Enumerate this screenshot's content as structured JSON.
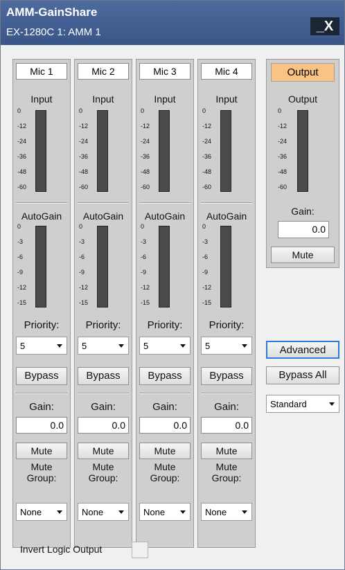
{
  "window": {
    "title": "AMM-GainShare",
    "subtitle": "EX-1280C 1: AMM 1",
    "close_label": "_X"
  },
  "channels": [
    {
      "name": "Mic 1",
      "input_label": "Input",
      "autogain_label": "AutoGain",
      "priority_label": "Priority:",
      "priority_value": "5",
      "bypass_label": "Bypass",
      "gain_label": "Gain:",
      "gain_value": "0.0",
      "mute_label": "Mute",
      "mute_group_label": "Mute Group:",
      "mute_group_value": "None"
    },
    {
      "name": "Mic 2",
      "input_label": "Input",
      "autogain_label": "AutoGain",
      "priority_label": "Priority:",
      "priority_value": "5",
      "bypass_label": "Bypass",
      "gain_label": "Gain:",
      "gain_value": "0.0",
      "mute_label": "Mute",
      "mute_group_label": "Mute Group:",
      "mute_group_value": "None"
    },
    {
      "name": "Mic 3",
      "input_label": "Input",
      "autogain_label": "AutoGain",
      "priority_label": "Priority:",
      "priority_value": "5",
      "bypass_label": "Bypass",
      "gain_label": "Gain:",
      "gain_value": "0.0",
      "mute_label": "Mute",
      "mute_group_label": "Mute Group:",
      "mute_group_value": "None"
    },
    {
      "name": "Mic 4",
      "input_label": "Input",
      "autogain_label": "AutoGain",
      "priority_label": "Priority:",
      "priority_value": "5",
      "bypass_label": "Bypass",
      "gain_label": "Gain:",
      "gain_value": "0.0",
      "mute_label": "Mute",
      "mute_group_label": "Mute Group:",
      "mute_group_value": "None"
    }
  ],
  "input_scale": [
    "0",
    "-12",
    "-24",
    "-36",
    "-48",
    "-60"
  ],
  "autogain_scale": [
    "0",
    "-3",
    "-6",
    "-9",
    "-12",
    "-15"
  ],
  "output": {
    "name": "Output",
    "meter_label": "Output",
    "gain_label": "Gain:",
    "gain_value": "0.0",
    "mute_label": "Mute",
    "scale": [
      "0",
      "-12",
      "-24",
      "-36",
      "-48",
      "-60"
    ]
  },
  "controls": {
    "advanced_label": "Advanced",
    "bypass_all_label": "Bypass All",
    "mode_value": "Standard"
  },
  "invert_logic_label": "Invert Logic Output",
  "colors": {
    "title_bar": "#3f5b8f",
    "output_button": "#f8c384",
    "meter": "#4a4a4a"
  }
}
